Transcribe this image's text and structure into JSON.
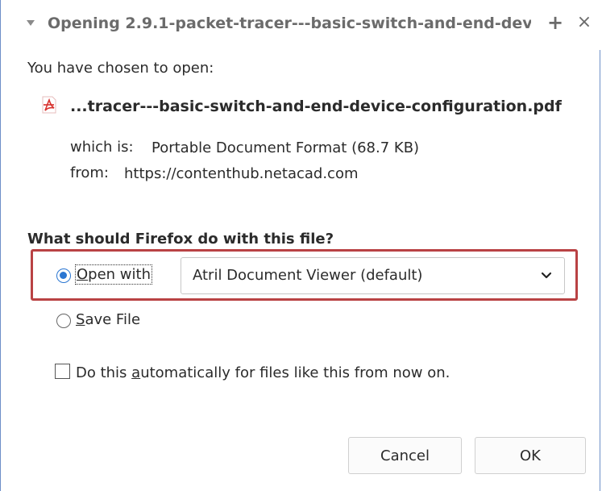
{
  "dialog": {
    "title": "Opening 2.9.1-packet-tracer---basic-switch-and-end-devi",
    "add_icon": "+",
    "close_icon": "×"
  },
  "file": {
    "intro": "You have chosen to open:",
    "name": "...tracer---basic-switch-and-end-device-configuration.pdf",
    "which_is_label": "which is:",
    "which_is_value": "Portable Document Format (68.7 KB)",
    "from_label": "from:",
    "from_value": "https://contenthub.netacad.com",
    "icon": "pdf-icon"
  },
  "action": {
    "heading": "What should Firefox do with this file?",
    "open_with_label": "Open with",
    "open_with_selected": true,
    "app_selected": "Atril Document Viewer (default)",
    "save_file_label": "Save File",
    "save_file_selected": false,
    "auto_label": "Do this automatically for files like this from now on.",
    "auto_checked": false
  },
  "buttons": {
    "cancel": "Cancel",
    "ok": "OK"
  },
  "colors": {
    "highlight_border": "#b94244",
    "radio_accent": "#2a76d2",
    "window_border": "#6d8fc8"
  }
}
